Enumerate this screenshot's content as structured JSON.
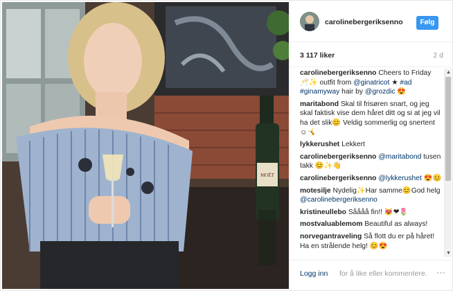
{
  "header": {
    "username": "carolinebergeriksenno",
    "follow_label": "Følg"
  },
  "stats": {
    "likes": "3 117 liker",
    "age": "2 d"
  },
  "comments": [
    {
      "user": "carolinebergeriksenno",
      "parts": [
        {
          "t": "text",
          "v": " Cheers to Friday 🥂✨ outfit from "
        },
        {
          "t": "link",
          "v": "@ginatricot"
        },
        {
          "t": "text",
          "v": " ★ "
        },
        {
          "t": "link",
          "v": "#ad #ginamyway"
        },
        {
          "t": "text",
          "v": " hair by "
        },
        {
          "t": "link",
          "v": "@grozdic"
        },
        {
          "t": "text",
          "v": " 😍"
        }
      ]
    },
    {
      "user": "maritabond",
      "parts": [
        {
          "t": "text",
          "v": " Skal til frisøren snart, og jeg skal faktisk vise dem håret ditt og si at jeg vil ha det slik😊 Veldig sommerlig og snertent☺🤸"
        }
      ]
    },
    {
      "user": "lykkerushet",
      "parts": [
        {
          "t": "text",
          "v": " Lekkert"
        }
      ]
    },
    {
      "user": "carolinebergeriksenno",
      "parts": [
        {
          "t": "text",
          "v": " "
        },
        {
          "t": "link",
          "v": "@maritabond"
        },
        {
          "t": "text",
          "v": " tusen takk 😊✨👋"
        }
      ]
    },
    {
      "user": "carolinebergeriksenno",
      "parts": [
        {
          "t": "text",
          "v": " "
        },
        {
          "t": "link",
          "v": "@lykkerushet"
        },
        {
          "t": "text",
          "v": " 😍😊"
        }
      ]
    },
    {
      "user": "motesilje",
      "parts": [
        {
          "t": "text",
          "v": " Nydelig✨Har samme😊God helg "
        },
        {
          "t": "link",
          "v": "@carolinebergeriksenno"
        }
      ]
    },
    {
      "user": "kristineullebo",
      "parts": [
        {
          "t": "text",
          "v": " Såååå fin!! 😻❤🌷"
        }
      ]
    },
    {
      "user": "mostvaluablemom",
      "parts": [
        {
          "t": "text",
          "v": " Beautiful as always!"
        }
      ]
    },
    {
      "user": "norvegantraveling",
      "parts": [
        {
          "t": "text",
          "v": " Så flott du er på håret! Ha en strålende helg! 😊😍"
        }
      ]
    }
  ],
  "footer": {
    "login_label": "Logg inn",
    "rest_label": "for å like eller kommentere.",
    "more_icon": "⋯"
  },
  "scrollbar": {
    "up_icon": "▲",
    "down_icon": "▼"
  },
  "photo": {
    "bottle_label": "MOËT"
  },
  "colors": {
    "follow_bg": "#3897f0",
    "link": "#003569",
    "muted": "#999999",
    "border": "#efefef"
  }
}
